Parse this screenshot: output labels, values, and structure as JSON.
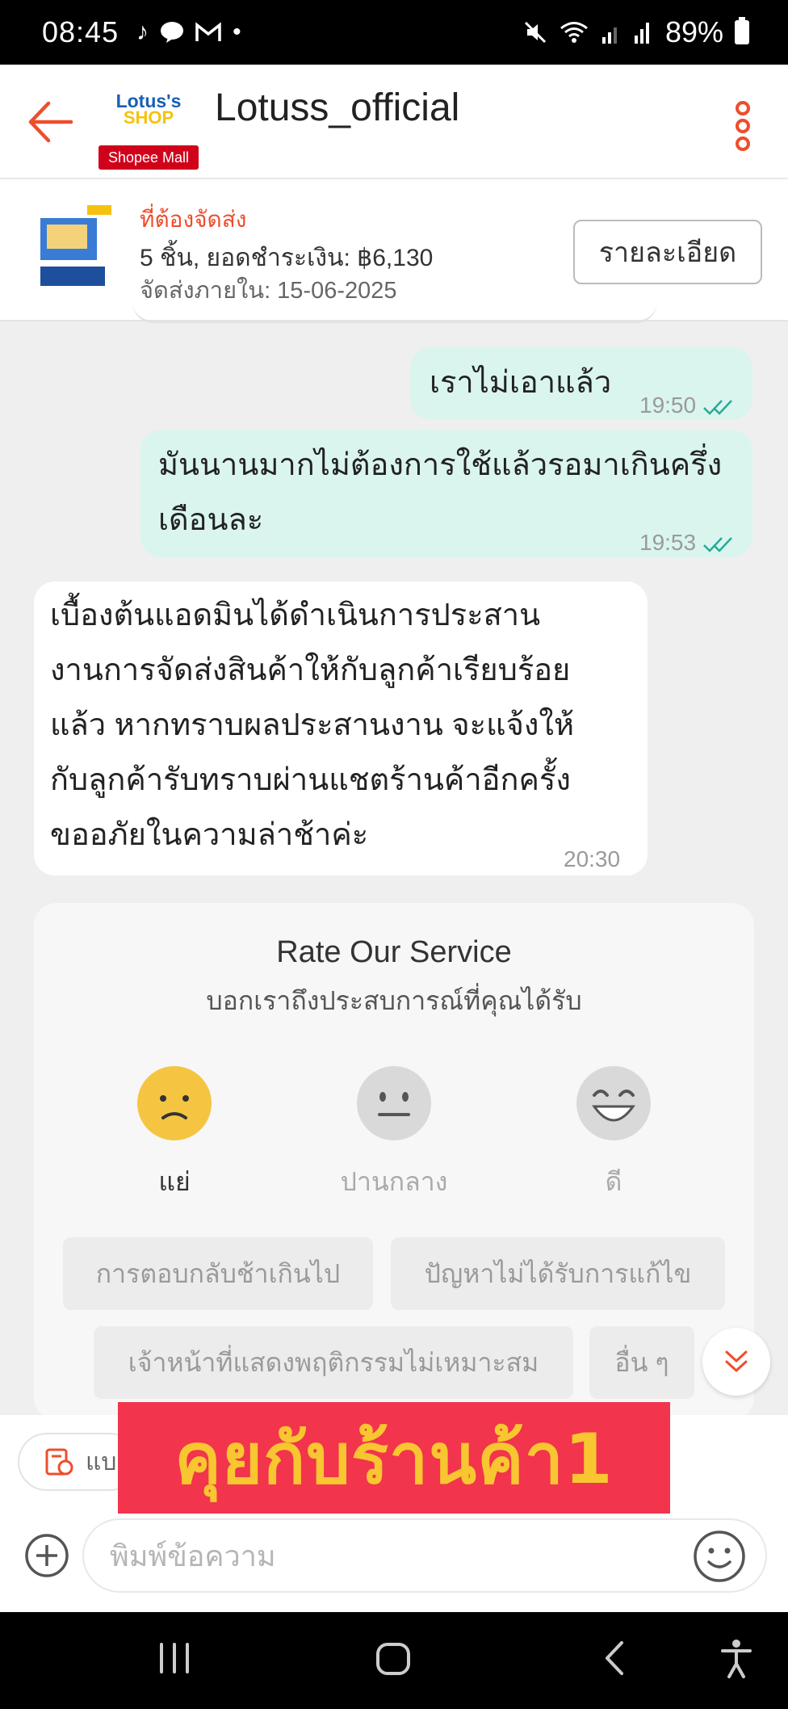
{
  "status_bar": {
    "time": "08:45",
    "battery": "89%",
    "icons": [
      "tiktok-icon",
      "line-icon",
      "gmail-icon",
      "dot-icon",
      "mute-icon",
      "wifi-icon",
      "signal-icon",
      "signal-icon",
      "battery-icon"
    ]
  },
  "header": {
    "shop_name": "Lotuss_official",
    "logo_line1": "Lotus's",
    "logo_line2": "SHOP",
    "mall_badge": "Shopee Mall"
  },
  "order": {
    "status": "ที่ต้องจัดส่ง",
    "summary": "5 ชิ้น, ยอดชำระเงิน: ฿6,130",
    "ship_by": "จัดส่งภายใน: 15-06-2025",
    "detail_button": "รายละเอียด"
  },
  "messages": [
    {
      "from": "me",
      "text": "เราไม่เอาแล้ว",
      "time": "19:50",
      "read": true
    },
    {
      "from": "me",
      "line1": "มันนานมากไม่ต้องการใช้แล้วรอมาเกินครึ่ง",
      "line2": "เดือนละ",
      "time": "19:53",
      "read": true
    },
    {
      "from": "them",
      "lines": [
        "เบื้องต้นแอดมินได้ดำเนินการประสาน",
        "งานการจัดส่งสินค้าให้กับลูกค้าเรียบร้อย",
        "แล้ว หากทราบผลประสานงาน จะแจ้งให้",
        "กับลูกค้ารับทราบผ่านแชตร้านค้าอีกครั้ง",
        "ขออภัยในความล่าช้าค่ะ"
      ],
      "time": "20:30"
    }
  ],
  "rating": {
    "title": "Rate Our Service",
    "subtitle": "บอกเราถึงประสบการณ์ที่คุณได้รับ",
    "options": [
      {
        "label": "แย่",
        "icon": "sad-face-icon",
        "selected": true,
        "color": "#f5c542"
      },
      {
        "label": "ปานกลาง",
        "icon": "neutral-face-icon",
        "selected": false,
        "color": "#d9d9d9"
      },
      {
        "label": "ดี",
        "icon": "happy-face-icon",
        "selected": false,
        "color": "#d9d9d9"
      }
    ],
    "chips": [
      "การตอบกลับช้าเกินไป",
      "ปัญหาไม่ได้รับการแก้ไข",
      "เจ้าหน้าที่แสดงพฤติกรรมไม่เหมาะสม",
      "อื่น ๆ"
    ]
  },
  "input": {
    "quick_label": "แบ",
    "placeholder": "พิมพ์ข้อความ"
  },
  "overlay_caption": "คุยกับร้านค้า1",
  "colors": {
    "accent": "#ee4d2d",
    "my_bubble": "#daf5ee",
    "read_check": "#26aa99",
    "overlay_bg": "#f2344c",
    "overlay_text": "#f8c630"
  }
}
